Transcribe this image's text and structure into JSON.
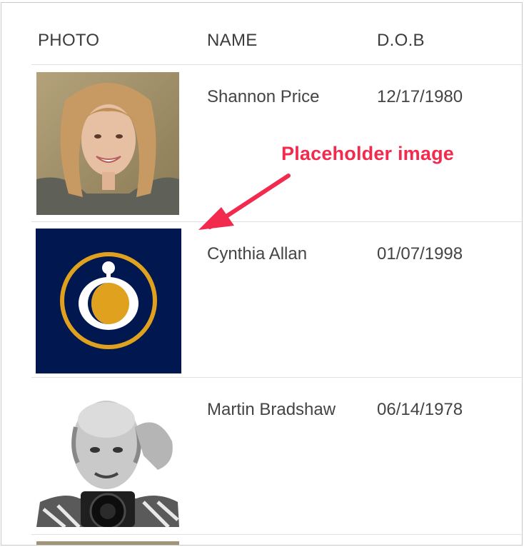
{
  "table": {
    "headers": {
      "photo": "PHOTO",
      "name": "NAME",
      "dob": "D.O.B"
    },
    "rows": [
      {
        "photo_icon": "woman-portrait-photo",
        "name": "Shannon Price",
        "dob": "12/17/1980"
      },
      {
        "photo_icon": "placeholder-logo-icon",
        "name": "Cynthia Allan",
        "dob": "01/07/1998"
      },
      {
        "photo_icon": "bald-man-camera-photo",
        "name": "Martin Bradshaw",
        "dob": "06/14/1978"
      }
    ]
  },
  "annotation": {
    "label": "Placeholder image",
    "color": "#f22a4d"
  },
  "colors": {
    "placeholder_bg": "#00174f",
    "placeholder_accent": "#e0a11e"
  }
}
